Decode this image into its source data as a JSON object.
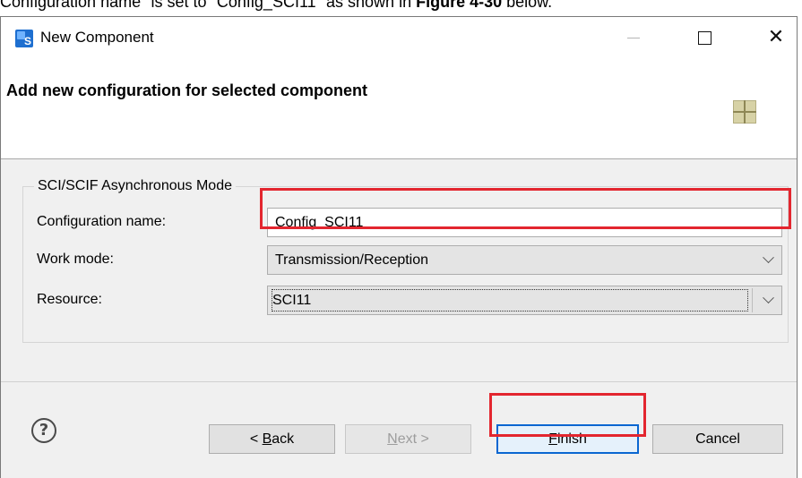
{
  "caption": {
    "pre": "Configuration name\" is set to \"Config_SCI11\" as shown in ",
    "bold": "Figure 4-30",
    "post": " below."
  },
  "window": {
    "title": "New Component",
    "app_icon_letter": "S"
  },
  "header": {
    "title": "Add new configuration for selected component",
    "icon": "component-grid-icon"
  },
  "group": {
    "legend": "SCI/SCIF Asynchronous Mode"
  },
  "form": {
    "config_name_label": "Configuration name:",
    "config_name_value": "Config_SCI11",
    "work_mode_label": "Work mode:",
    "work_mode_value": "Transmission/Reception",
    "resource_label": "Resource:",
    "resource_value": "SCI11"
  },
  "buttons": {
    "help_glyph": "?",
    "back_pre": "< ",
    "back_key": "B",
    "back_post": "ack",
    "next_key": "N",
    "next_post": "ext >",
    "finish_key": "F",
    "finish_post": "inish",
    "cancel": "Cancel"
  },
  "colors": {
    "highlight": "#e3262f",
    "focus": "#0a66d1",
    "app_icon": "#1e6fd0"
  }
}
